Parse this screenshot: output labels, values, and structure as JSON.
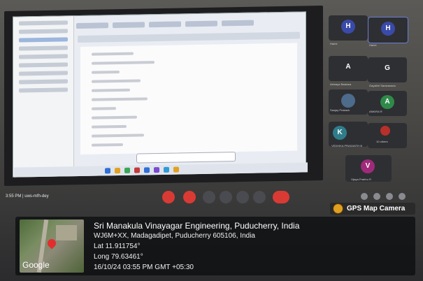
{
  "meeting": {
    "time_label": "3:55 PM | uws-mfh-dey"
  },
  "participants": [
    {
      "initial": "H",
      "name": "Harini",
      "color": "#3a4aa8"
    },
    {
      "initial": "H",
      "name": "Harini",
      "color": "#3a4aa8"
    },
    {
      "initial": "A",
      "name": "Abinaya Baskara",
      "color": "#2e2f33"
    },
    {
      "initial": "G",
      "name": "Gayathri Saravanadu",
      "color": "#2e2f33"
    },
    {
      "initial": "",
      "name": "Sanjay Prakash",
      "color": "#4d6b8a"
    },
    {
      "initial": "A",
      "name": "ANKIRA R",
      "color": "#2f8a4a"
    },
    {
      "initial": "K",
      "name": "VEDHIKA PRASANTH B",
      "color": "#2f7d8a"
    },
    {
      "initial": "",
      "name": "10 others",
      "color": "#b7302a"
    },
    {
      "initial": "V",
      "name": "Vijaya Prabhu R",
      "color": "#a02a7a"
    }
  ],
  "gps": {
    "badge_label": "GPS Map Camera",
    "place": "Sri Manakula Vinayagar Engineering, Puducherry, India",
    "address": "WJ6M+XX, Madagadipet, Puducherry 605106, India",
    "lat": "Lat 11.911754°",
    "long": "Long 79.63461°",
    "datetime": "16/10/24 03:55 PM GMT +05:30",
    "map_brand": "Google"
  }
}
